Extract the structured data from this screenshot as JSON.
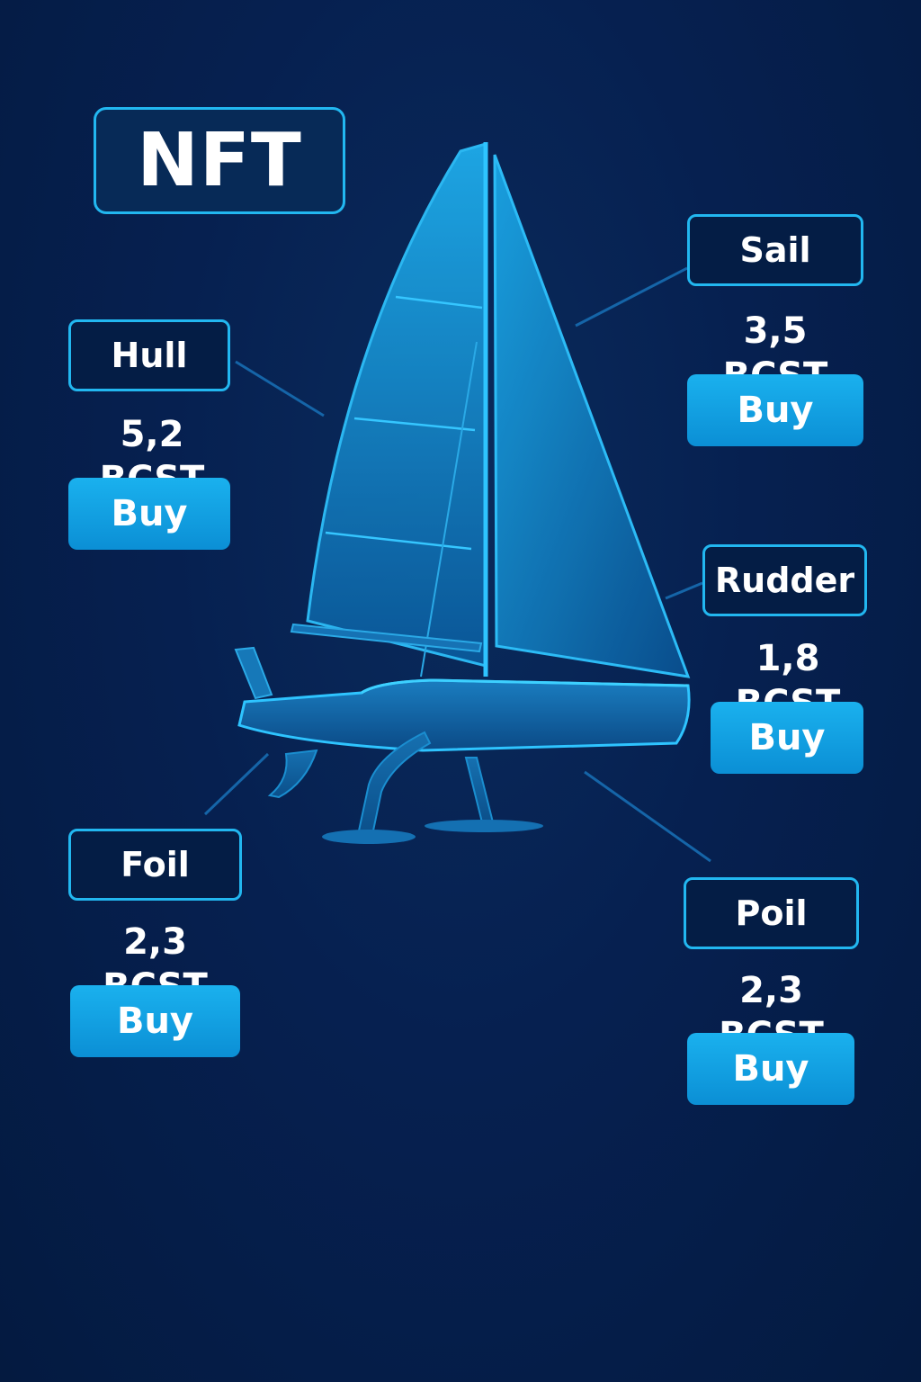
{
  "header": {
    "title": "NFT"
  },
  "colors": {
    "background": "#06204a",
    "accent": "#22b7f0",
    "button": "#1ab1ee",
    "boat": "#1a8ed0"
  },
  "parts": {
    "hull": {
      "name": "Hull",
      "price": "5,2 BCST",
      "buy_label": "Buy"
    },
    "sail": {
      "name": "Sail",
      "price": "3,5 BCST",
      "buy_label": "Buy"
    },
    "rudder": {
      "name": "Rudder",
      "price": "1,8 BCST",
      "buy_label": "Buy"
    },
    "foil": {
      "name": "Foil",
      "price": "2,3 BCST",
      "buy_label": "Buy"
    },
    "poil": {
      "name": "Poil",
      "price": "2,3 BCST",
      "buy_label": "Buy"
    }
  }
}
